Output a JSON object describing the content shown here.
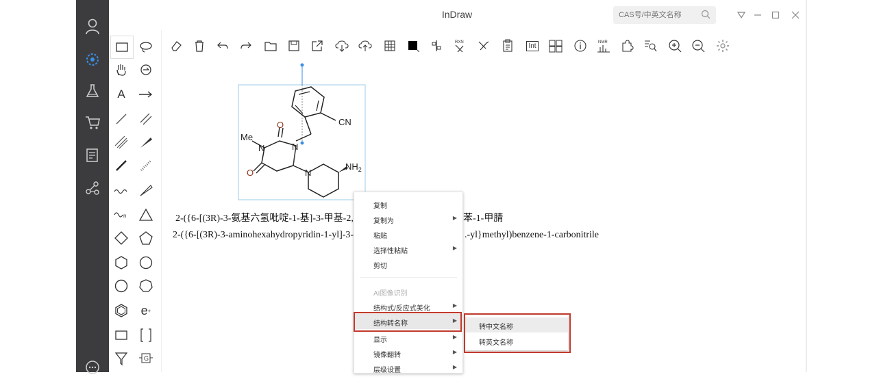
{
  "app": {
    "title": "InDraw",
    "search_placeholder": "CAS号/中英文名称"
  },
  "canvas": {
    "name_cn": "2-({6-[(3R)-3-氨基六氢吡啶-1-基]-3-甲基-2,4",
    "name_cn_tail": "苯-1-甲腈",
    "name_en": "2-({6-[(3R)-3-aminohexahydropyridin-1-yl]-3-r",
    "name_en_tail": ".-yl}methyl)benzene-1-carbonitrile",
    "atoms": {
      "cn": "CN",
      "me": "Me",
      "n1": "N",
      "n2": "N",
      "n3": "N",
      "o1": "O",
      "o2": "O",
      "nh2": "NH",
      "nh2_sub": "2"
    }
  },
  "toolbar": {
    "rxn": "RXN",
    "int": "Int",
    "nmr": "NMR"
  },
  "context_menu": {
    "items": [
      {
        "label": "复制"
      },
      {
        "label": "复制为",
        "submenu": true
      },
      {
        "label": "粘贴"
      },
      {
        "label": "选择性粘贴",
        "submenu": true
      },
      {
        "label": "剪切"
      },
      {
        "label": "AI图像识别",
        "disabled": true
      },
      {
        "label": "结构式/反应式美化",
        "submenu": true
      },
      {
        "label": "结构转名称",
        "submenu": true,
        "highlighted": true
      },
      {
        "label": "显示",
        "submenu": true
      },
      {
        "label": "镜像翻转",
        "submenu": true
      },
      {
        "label": "层级设置",
        "submenu": true
      }
    ]
  },
  "submenu": {
    "items": [
      {
        "label": "转中文名称"
      },
      {
        "label": "转英文名称"
      }
    ]
  },
  "colors": {
    "sidebar": "#3c3c3e",
    "accent": "#3a8ee6",
    "highlight_border": "#c0392b"
  }
}
